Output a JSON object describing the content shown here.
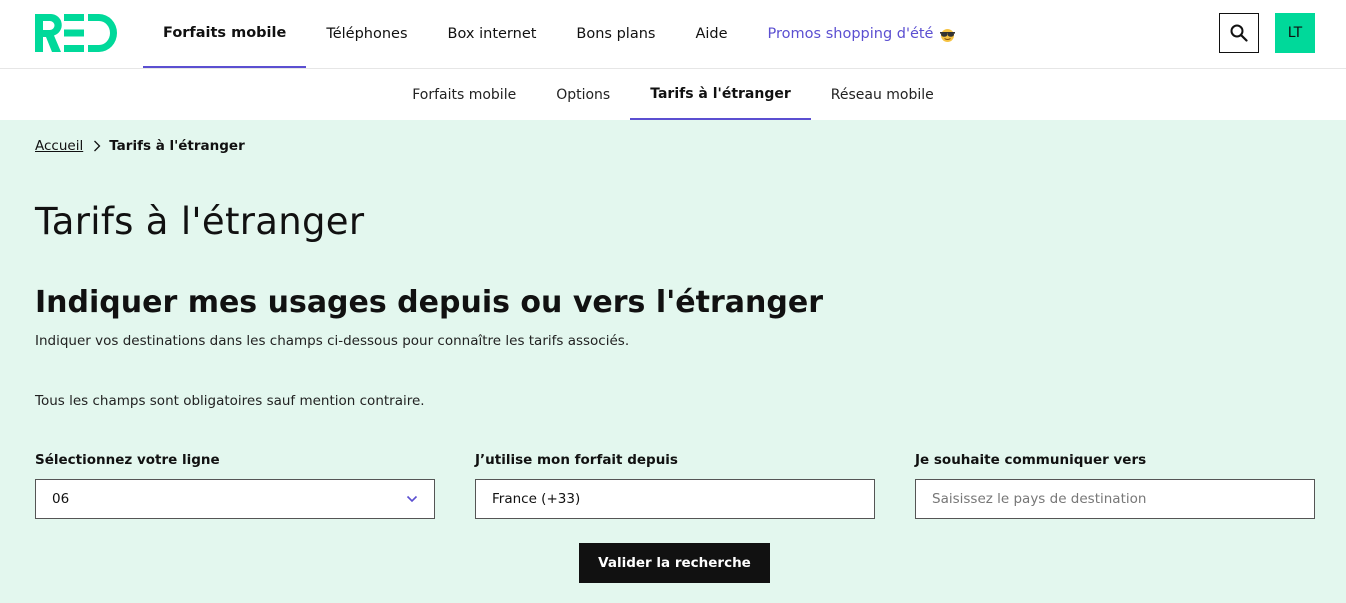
{
  "header": {
    "logo_text": "RED",
    "nav": [
      {
        "label": "Forfaits mobile"
      },
      {
        "label": "Téléphones"
      },
      {
        "label": "Box internet"
      },
      {
        "label": "Bons plans"
      },
      {
        "label": "Aide"
      },
      {
        "label": "Promos shopping d'été"
      }
    ],
    "search_icon": "search-icon",
    "avatar_initials": "LT"
  },
  "subnav": [
    {
      "label": "Forfaits mobile"
    },
    {
      "label": "Options"
    },
    {
      "label": "Tarifs à l'étranger"
    },
    {
      "label": "Réseau mobile"
    }
  ],
  "breadcrumb": {
    "home": "Accueil",
    "current": "Tarifs à l'étranger"
  },
  "page": {
    "title": "Tarifs à l'étranger",
    "section_title": "Indiquer mes usages depuis ou vers l'étranger",
    "section_desc": "Indiquer vos destinations dans les champs ci-dessous pour connaître les tarifs associés.",
    "required_note": "Tous les champs sont obligatoires sauf mention contraire."
  },
  "form": {
    "line_label": "Sélectionnez votre ligne",
    "line_value": "06",
    "from_label": "J’utilise mon forfait depuis",
    "from_value": "France (+33)",
    "to_label": "Je souhaite communiquer vers",
    "to_placeholder": "Saisissez le pays de destination",
    "submit_label": "Valider la recherche"
  },
  "colors": {
    "brand": "#00d99a",
    "accent": "#5b4fd1",
    "background": "#e3f7ee"
  }
}
